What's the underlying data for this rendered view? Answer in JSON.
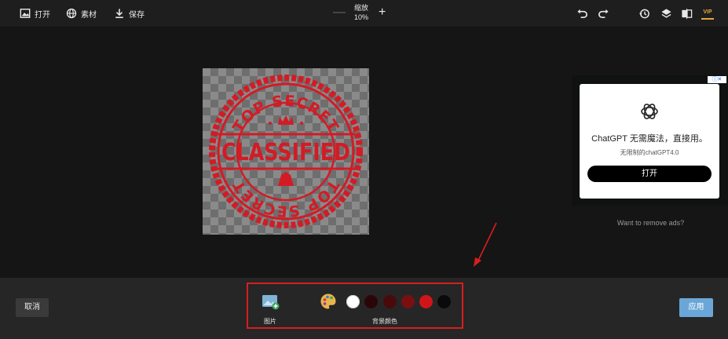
{
  "toolbar": {
    "open_label": "打开",
    "assets_label": "素材",
    "save_label": "保存",
    "zoom_label": "缩放",
    "zoom_value": "10%",
    "zoom_out_symbol": "—",
    "zoom_in_symbol": "+",
    "vip_label": "VIP",
    "icons": [
      "image-icon",
      "globe-icon",
      "download-icon",
      "undo-icon",
      "redo-icon",
      "history-icon",
      "layers-icon",
      "compare-icon",
      "vip-icon"
    ]
  },
  "canvas": {
    "stamp_text_top": "TOP SECRET",
    "stamp_text_center": "CLASSIFIED",
    "stamp_text_bottom": "TOP SECRET",
    "stamp_color": "#d31b25"
  },
  "ad": {
    "title": "ChatGPT 无需魔法，直接用。",
    "subtitle": "无限制的chatGPT4.0",
    "button_label": "打开",
    "badge": "ⓘ✕",
    "remove_ads": "Want to remove ads?"
  },
  "bottom": {
    "cancel_label": "取消",
    "apply_label": "应用",
    "image_label": "图片",
    "bg_color_label": "背景颜色",
    "swatches": [
      "#ffffff",
      "#2b0608",
      "#4a0a0c",
      "#7a0f12",
      "#d0151a",
      "#0a0a0a"
    ],
    "highlight_color": "#d81e1e",
    "apply_color": "#6aa7d8"
  }
}
